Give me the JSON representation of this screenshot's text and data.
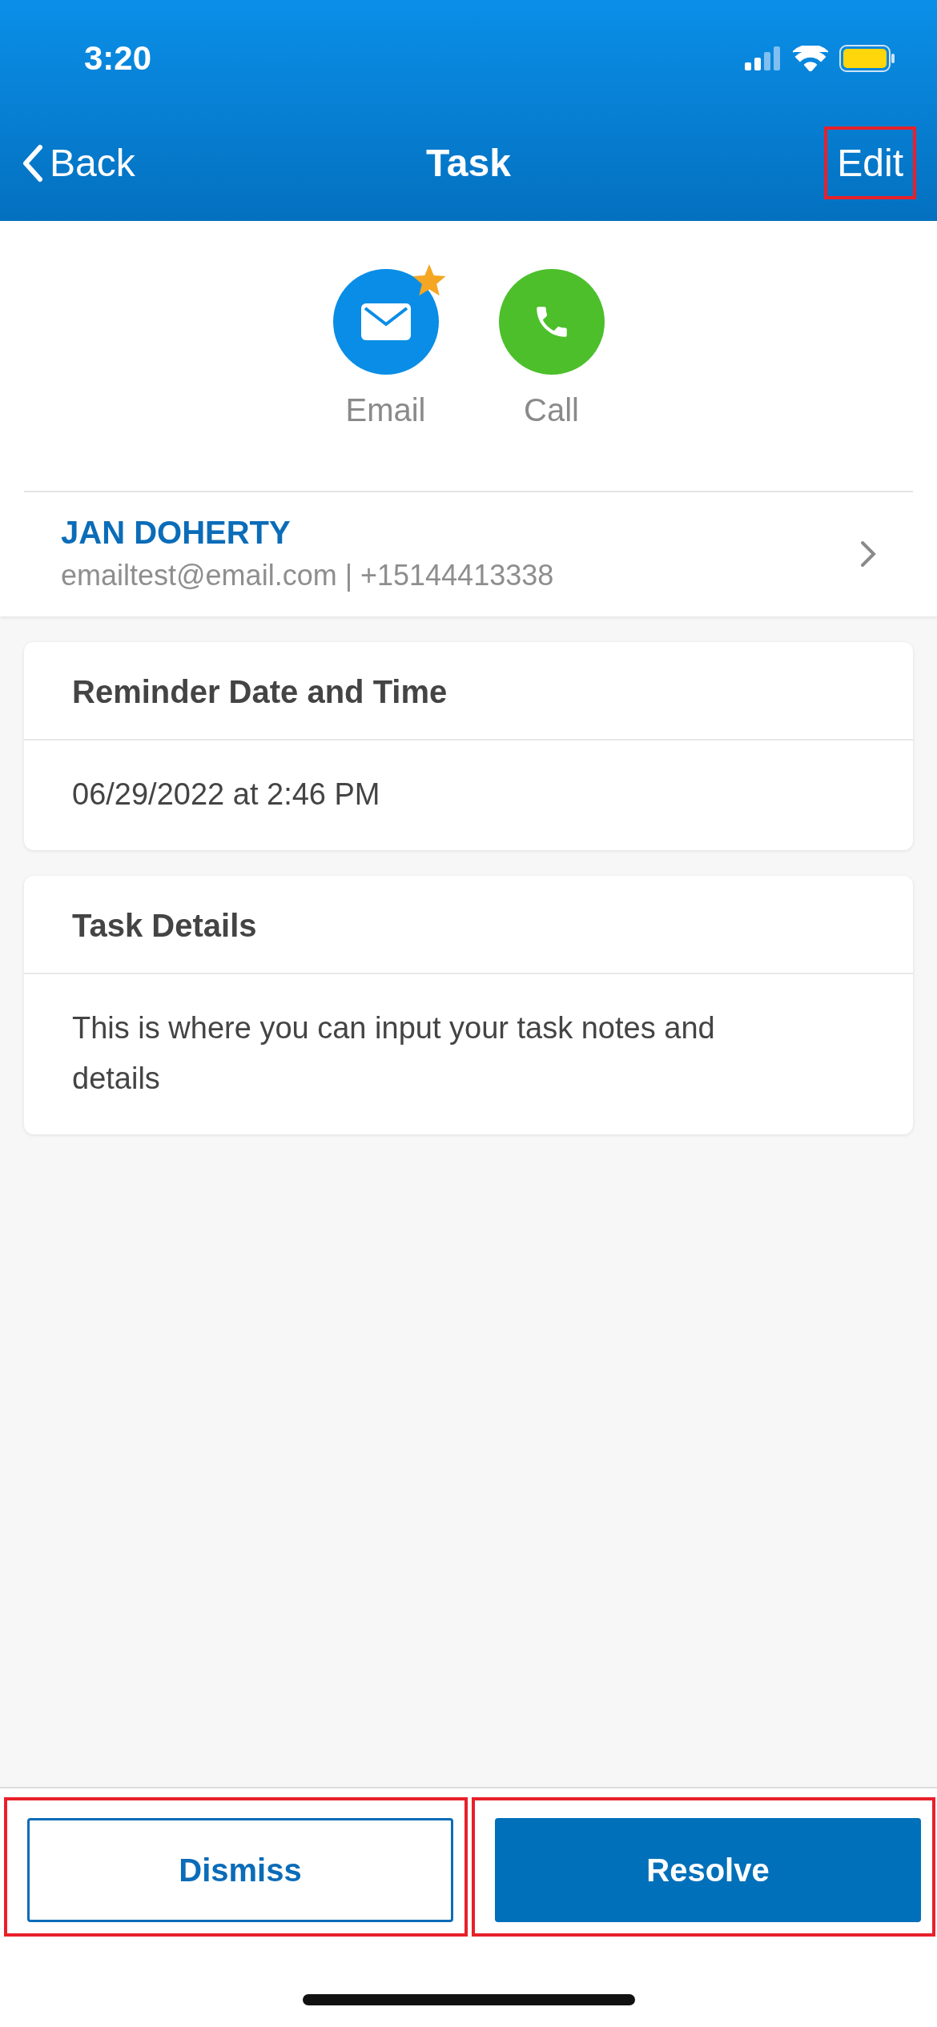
{
  "status_bar": {
    "time": "3:20"
  },
  "nav": {
    "back": "Back",
    "title": "Task",
    "edit": {
      "label": "Edit",
      "highlighted": true
    }
  },
  "actions": [
    {
      "kind": "email",
      "label": "Email",
      "badge": true
    },
    {
      "kind": "call",
      "label": "Call",
      "badge": false
    }
  ],
  "contact": {
    "name": "JAN DOHERTY",
    "details": "emailtest@email.com | +15144413338"
  },
  "cards": [
    {
      "title": "Reminder Date and Time",
      "body": "06/29/2022 at 2:46 PM"
    },
    {
      "title": "Task Details",
      "body": "This is where you can input your task notes and details"
    }
  ],
  "buttons": [
    {
      "kind": "outline",
      "label": "Dismiss",
      "highlighted": true
    },
    {
      "kind": "filled",
      "label": "Resolve",
      "highlighted": true
    }
  ]
}
